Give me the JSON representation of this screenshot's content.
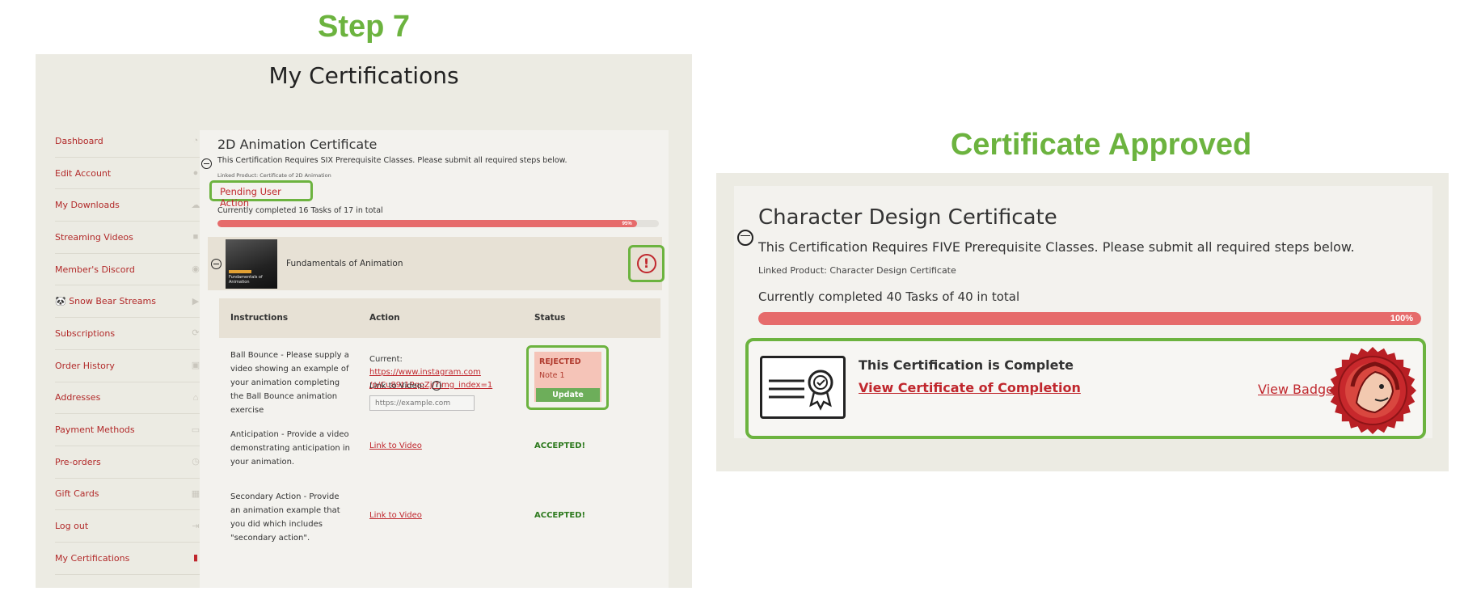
{
  "step_title": "Step 7",
  "left": {
    "page_title": "My Certifications",
    "sidebar": [
      {
        "label": "Dashboard",
        "icon": "gauge-icon"
      },
      {
        "label": "Edit Account",
        "icon": "user-icon"
      },
      {
        "label": "My Downloads",
        "icon": "cloud-download-icon"
      },
      {
        "label": "Streaming Videos",
        "icon": "video-camera-icon"
      },
      {
        "label": "Member's Discord",
        "icon": "discord-icon"
      },
      {
        "label": "🐼 Snow Bear Streams",
        "icon": "play-icon"
      },
      {
        "label": "Subscriptions",
        "icon": "refresh-icon"
      },
      {
        "label": "Order History",
        "icon": "basket-icon"
      },
      {
        "label": "Addresses",
        "icon": "home-icon"
      },
      {
        "label": "Payment Methods",
        "icon": "credit-card-icon"
      },
      {
        "label": "Pre-orders",
        "icon": "clock-icon"
      },
      {
        "label": "Gift Cards",
        "icon": "gift-icon"
      },
      {
        "label": "Log out",
        "icon": "logout-icon"
      },
      {
        "label": "My Certifications",
        "icon": "document-icon"
      }
    ],
    "certificate": {
      "title": "2D Animation Certificate",
      "description": "This Certification Requires SIX Prerequisite Classes. Please submit all required steps below.",
      "linked_product": "Linked Product: Certificate of 2D Animation",
      "status": "Pending User Action",
      "progress_text": "Currently completed 16 Tasks of 17 in total",
      "progress_percent": 95,
      "progress_label": "95%",
      "class": {
        "name": "Fundamentals of Animation",
        "thumbnail_text": "Fundamentals of Animation"
      },
      "table_headers": {
        "instructions": "Instructions",
        "action": "Action",
        "status": "Status"
      },
      "rows": [
        {
          "instructions": "Ball Bounce - Please supply a video showing an example of your animation completing the Ball Bounce animation exercise",
          "current_label": "Current:",
          "current_url_line1": "https://www.instagram.com",
          "current_url_line2": "/p/Cu89t1PqoZj/?img_index=1",
          "link_label": "Link to Video:",
          "input_placeholder": "https://example.com",
          "status_title": "REJECTED",
          "status_note": "Note 1",
          "button": "Update"
        },
        {
          "instructions": "Anticipation - Provide a video demonstrating anticipation in your animation.",
          "action": "Link to Video",
          "status": "ACCEPTED!"
        },
        {
          "instructions": "Secondary Action - Provide an animation example that you did which includes \"secondary action\".",
          "action": "Link to Video",
          "status": "ACCEPTED!"
        }
      ]
    }
  },
  "right": {
    "title": "Certificate Approved",
    "certificate": {
      "title": "Character Design Certificate",
      "description": "This Certification Requires FIVE Prerequisite Classes. Please submit all required steps below.",
      "linked_product": "Linked Product: Character Design Certificate",
      "progress_text": "Currently completed 40 Tasks of 40 in total",
      "progress_percent": 100,
      "progress_label": "100%",
      "complete_text": "This Certification is Complete",
      "view_certificate": "View Certificate of Completion",
      "view_badge": "View Badge"
    }
  },
  "colors": {
    "accent_green": "#6cb33f",
    "link_red": "#c0272d",
    "progress_red": "#e66b6b"
  }
}
